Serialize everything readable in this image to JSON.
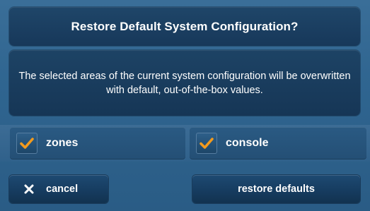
{
  "dialog": {
    "title": "Restore Default System Configuration?",
    "message": "The selected areas of the current system configuration will be overwritten with default, out-of-the-box values."
  },
  "options": [
    {
      "label": "zones",
      "checked": true,
      "icon": "checkmark-icon"
    },
    {
      "label": "console",
      "checked": true,
      "icon": "checkmark-icon"
    }
  ],
  "buttons": {
    "cancel_label": "cancel",
    "cancel_icon": "close-icon",
    "restore_label": "restore defaults"
  },
  "colors": {
    "background": "#2b5d86",
    "panel": "#1a3d5f",
    "checkmark": "#f29a1d"
  }
}
